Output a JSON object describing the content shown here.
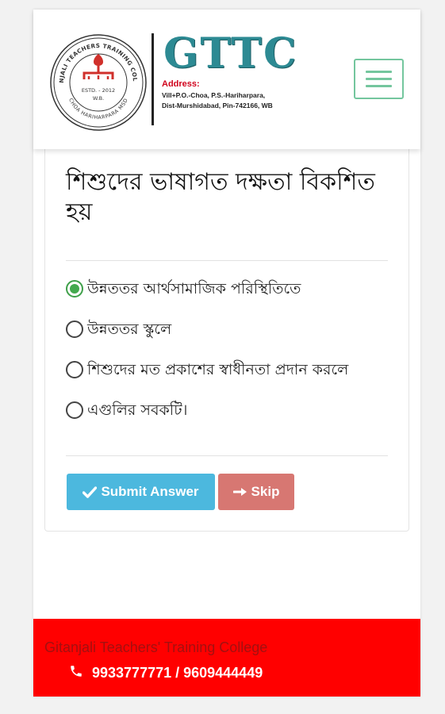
{
  "header": {
    "seal_text_top": "GITANJALI TEACHERS TRAINING COLLEGE",
    "seal_text_bottom": "CHOA HARIHARPARA MSD",
    "seal_estd": "ESTD. - 2012",
    "seal_state": "W.B.",
    "title": "GTTC",
    "address_label": "Address:",
    "address_line1": "Vill+P.O.-Choa, P.S.-Hariharpara,",
    "address_line2": "Dist-Murshidabad, Pin-742166, WB",
    "menu_icon": "hamburger-icon"
  },
  "quiz": {
    "question": "শিশুদের ভাষাগত দক্ষতা বিকশিত হয়",
    "options": [
      {
        "label": "উন্নততর আর্থসামাজিক পরিস্থিতিতে",
        "selected": true
      },
      {
        "label": "উন্নততর স্কুলে",
        "selected": false
      },
      {
        "label": "শিশুদের মত প্রকাশের স্বাধীনতা প্রদান করলে",
        "selected": false
      },
      {
        "label": "এগুলির সবকটি।",
        "selected": false
      }
    ],
    "submit_label": "Submit Answer",
    "skip_label": "Skip",
    "submit_icon": "checkmark-icon",
    "skip_icon": "arrow-right-icon"
  },
  "footer": {
    "college_name": "Gitanjali Teachers' Training College",
    "phone_icon": "phone-icon",
    "phones": "9933777771 / 9609444449"
  },
  "colors": {
    "brand_teal": "#2d8a93",
    "address_red": "#d0021b",
    "menu_green": "#74c69e",
    "radio_green": "#43a94e",
    "submit_blue": "#4cb8de",
    "skip_red": "#d77772",
    "footer_red": "#ff0000"
  }
}
